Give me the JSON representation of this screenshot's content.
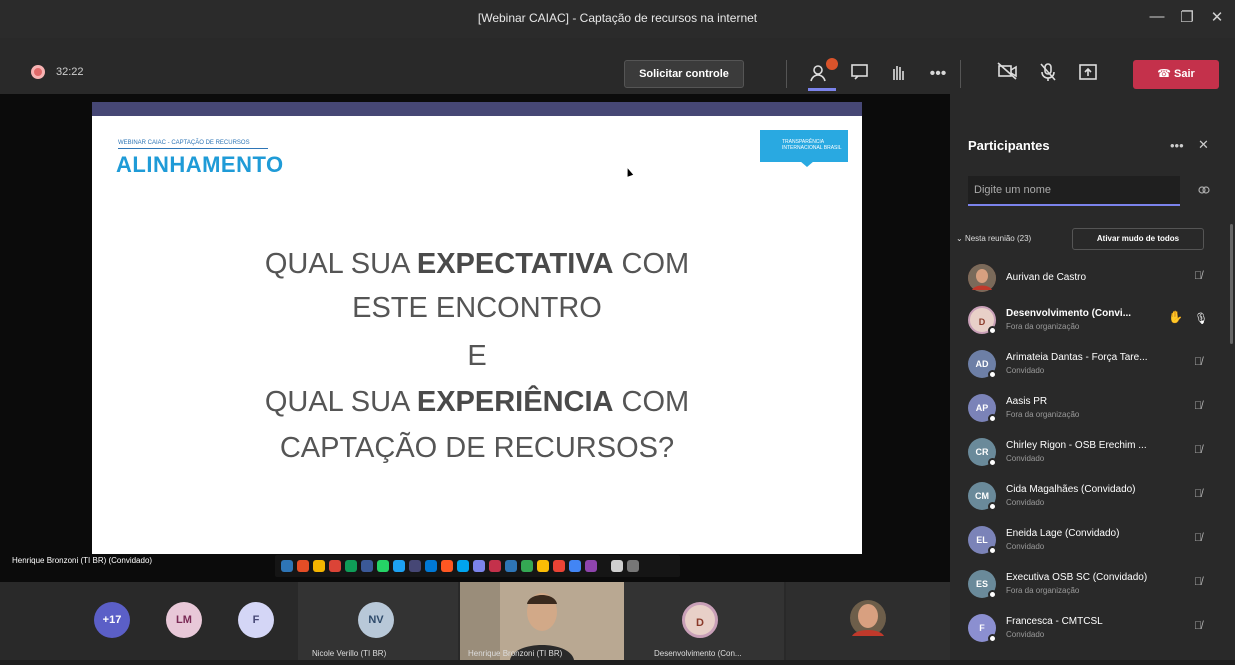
{
  "window": {
    "title": "[Webinar CAIAC] - Captação de recursos na internet",
    "controls": [
      "—",
      "❐",
      "✕"
    ]
  },
  "call": {
    "timer": "32:22",
    "request_control": "Solicitar controle",
    "leave": "Sair",
    "icons": [
      "participants-icon",
      "chat-icon",
      "raise-hand-icon",
      "more-options-icon",
      "video-off-icon",
      "mic-off-icon",
      "share-icon"
    ]
  },
  "slide": {
    "kicker": "WEBINAR CAIAC - CAPTAÇÃO DE RECURSOS",
    "heading": "ALINHAMENTO",
    "logo_text": "TRANSPARÊNCIA INTERNACIONAL BRASIL",
    "line1_a": "QUAL SUA ",
    "line1_b": "EXPECTATIVA",
    "line1_c": " COM",
    "line2": "ESTE ENCONTRO",
    "line3": "E",
    "line4_a": "QUAL SUA ",
    "line4_b": "EXPERIÊNCIA",
    "line4_c": " COM",
    "line5": "CAPTAÇÃO DE RECURSOS?"
  },
  "presenter": {
    "name": "Henrique Bronzoni (TI BR) (Convidado)"
  },
  "gallery": {
    "overflow": "+17",
    "tiles": [
      {
        "initials": "LM",
        "name": ""
      },
      {
        "initials": "F",
        "name": ""
      },
      {
        "initials": "NV",
        "name": "Nicole Verillo (TI BR)"
      },
      {
        "initials": "",
        "name": "Henrique Bronzoni (TI BR)"
      },
      {
        "initials": "D",
        "name": "Desenvolvimento (Con..."
      }
    ]
  },
  "participants_panel": {
    "title": "Participantes",
    "search_placeholder": "Digite um nome",
    "section_label": "Nesta reunião (23)",
    "mute_all": "Ativar mudo de todos",
    "people": [
      {
        "initials": "",
        "name": "Aurivan de Castro",
        "role": "",
        "color": "#8a3a2a"
      },
      {
        "initials": "D",
        "name": "Desenvolvimento (Convi...",
        "role": "Fora da organização",
        "color": "#c9a0b8"
      },
      {
        "initials": "AD",
        "name": "Arimateia Dantas - Força Tare...",
        "role": "Convidado",
        "color": "#6d7fa6"
      },
      {
        "initials": "AP",
        "name": "Aasis PR",
        "role": "Fora da organização",
        "color": "#7b83b8"
      },
      {
        "initials": "CR",
        "name": "Chirley Rigon - OSB Erechim ...",
        "role": "Convidado",
        "color": "#6a8a9a"
      },
      {
        "initials": "CM",
        "name": "Cida Magalhães (Convidado)",
        "role": "Convidado",
        "color": "#6a8a9a"
      },
      {
        "initials": "EL",
        "name": "Eneida Lage (Convidado)",
        "role": "Convidado",
        "color": "#7b83b8"
      },
      {
        "initials": "ES",
        "name": "Executiva OSB SC (Convidado)",
        "role": "Fora da organização",
        "color": "#6a8a9a"
      },
      {
        "initials": "F",
        "name": "Francesca - CMTCSL",
        "role": "Convidado",
        "color": "#8b8fd0"
      }
    ]
  }
}
